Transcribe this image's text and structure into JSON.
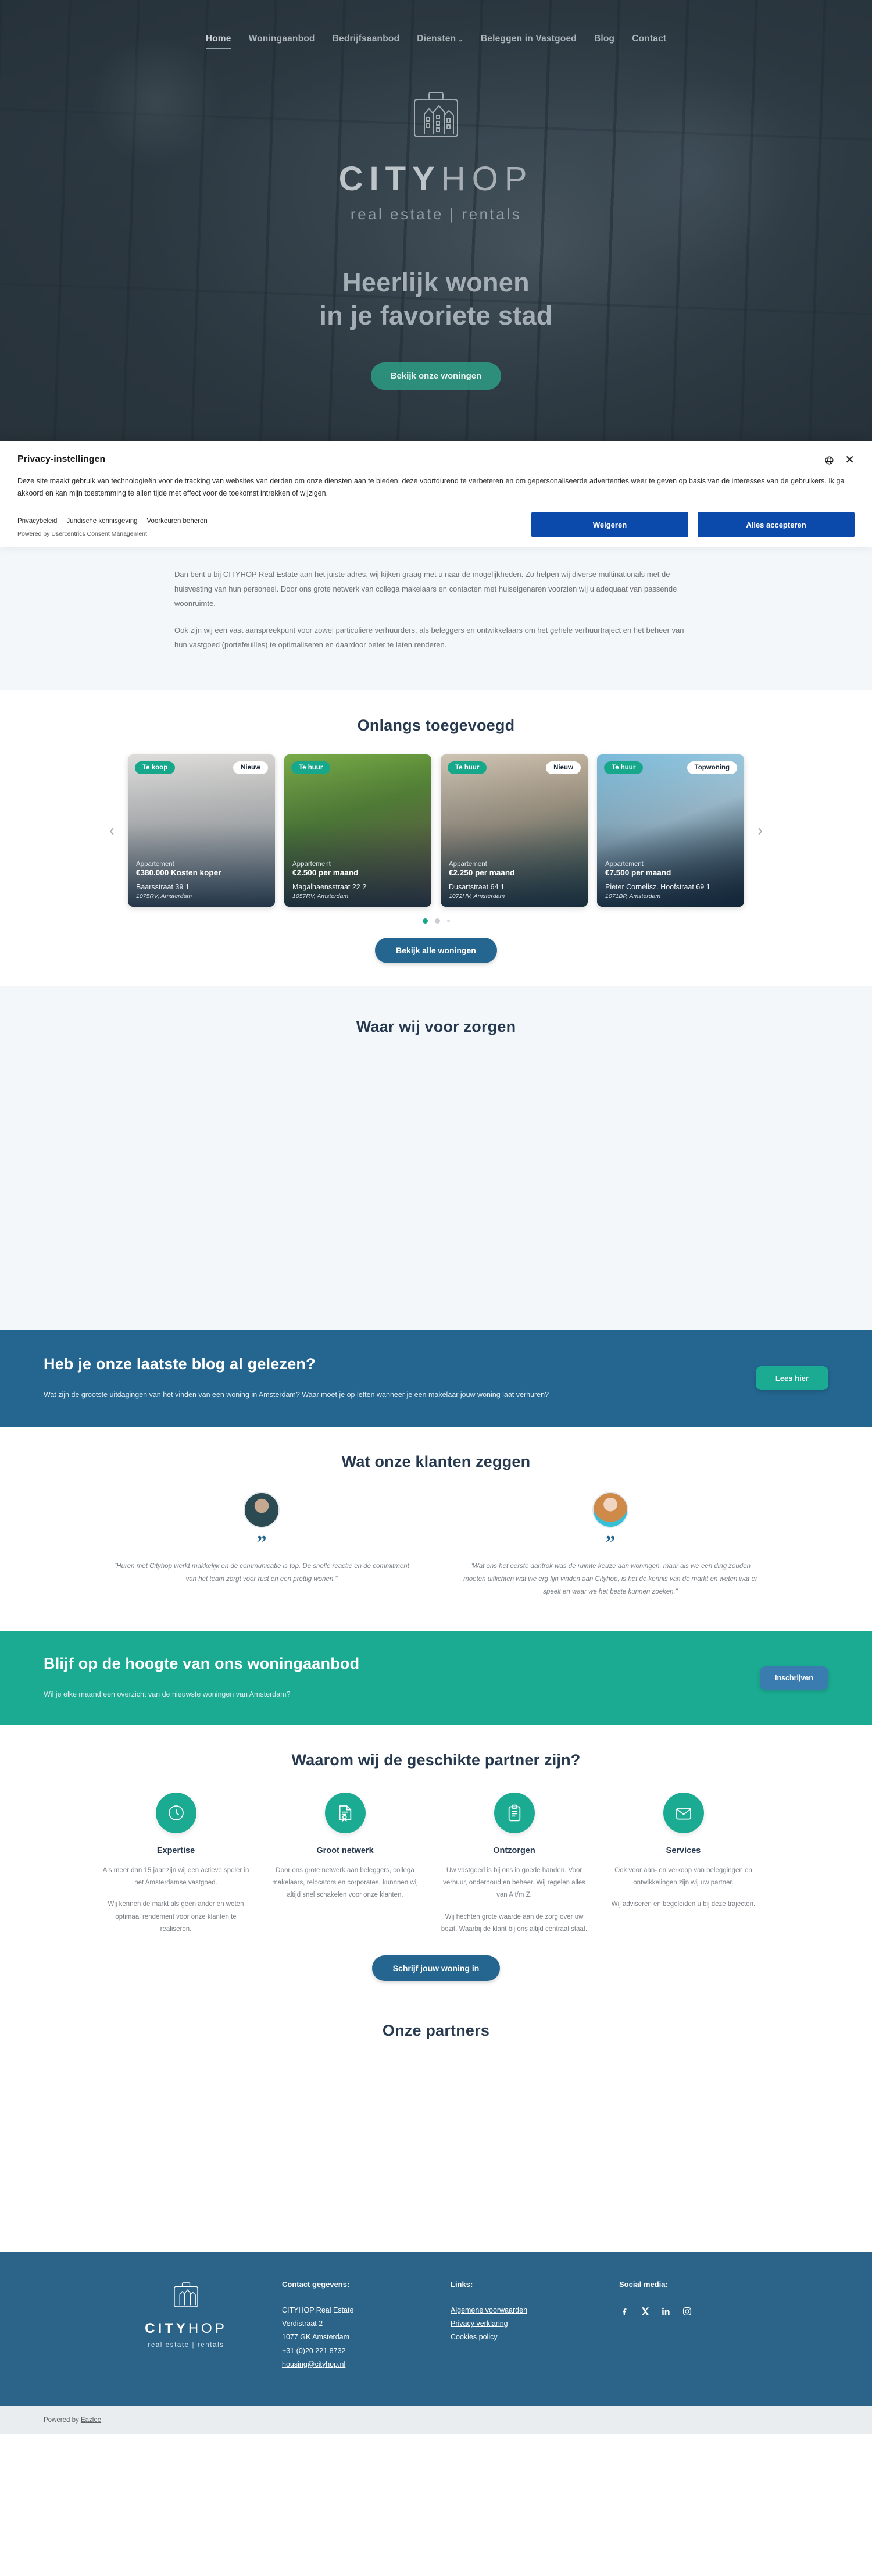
{
  "nav": {
    "items": [
      {
        "label": "Home",
        "active": true,
        "caret": false
      },
      {
        "label": "Woningaanbod",
        "active": false,
        "caret": false
      },
      {
        "label": "Bedrijfsaanbod",
        "active": false,
        "caret": false
      },
      {
        "label": "Diensten",
        "active": false,
        "caret": true
      },
      {
        "label": "Beleggen in Vastgoed",
        "active": false,
        "caret": false
      },
      {
        "label": "Blog",
        "active": false,
        "caret": false
      },
      {
        "label": "Contact",
        "active": false,
        "caret": false
      }
    ],
    "caret_glyph": "⌄"
  },
  "hero": {
    "brand_bold": "CITY",
    "brand_light": "HOP",
    "tagline": "real estate | rentals",
    "title_line1": "Heerlijk wonen",
    "title_line2": "in je favoriete stad",
    "cta": "Bekijk onze woningen"
  },
  "cookie": {
    "title": "Privacy-instellingen",
    "body": "Deze site maakt gebruik van technologieën voor de tracking van websites van derden om onze diensten aan te bieden, deze voortdurend te verbeteren en om gepersonaliseerde advertenties weer te geven op basis van de interesses van de gebruikers. Ik ga akkoord en kan mijn toestemming te allen tijde met effect voor de toekomst intrekken of wijzigen.",
    "links": [
      "Privacybeleid",
      "Juridische kennisgeving",
      "Voorkeuren beheren"
    ],
    "powered": "Powered by Usercentrics Consent Management",
    "deny": "Weigeren",
    "accept": "Alles accepteren",
    "close_glyph": "✕"
  },
  "intro": {
    "p1": "Dan bent u bij CITYHOP Real Estate aan het juiste adres, wij kijken graag met u naar de mogelijkheden. Zo helpen wij diverse multinationals met de huisvesting van hun personeel. Door ons grote netwerk van collega makelaars en contacten met huiseigenaren voorzien wij u adequaat van passende woonruimte.",
    "p2": "Ook zijn wij een vast aanspreekpunt voor zowel particuliere verhuurders, als beleggers en ontwikkelaars om het gehele verhuurtraject en het beheer van hun vastgoed (portefeuilles) te optimaliseren en daardoor beter te laten renderen."
  },
  "recent": {
    "title": "Onlangs toegevoegd",
    "arrow_left": "‹",
    "arrow_right": "›",
    "cta": "Bekijk alle woningen",
    "cards": [
      {
        "status": "Te koop",
        "tag": "Nieuw",
        "type": "Appartement",
        "price": "€380.000 Kosten koper",
        "street": "Baarsstraat 39 1",
        "zip": "1075RV, Amsterdam"
      },
      {
        "status": "Te huur",
        "tag": "",
        "type": "Appartement",
        "price": "€2.500 per maand",
        "street": "Magalhaensstraat 22 2",
        "zip": "1057RV, Amsterdam"
      },
      {
        "status": "Te huur",
        "tag": "Nieuw",
        "type": "Appartement",
        "price": "€2.250 per maand",
        "street": "Dusartstraat 64 1",
        "zip": "1072HV, Amsterdam"
      },
      {
        "status": "Te huur",
        "tag": "Topwoning",
        "type": "Appartement",
        "price": "€7.500 per maand",
        "street": "Pieter Cornelisz. Hoofstraat 69 1",
        "zip": "1071BP, Amsterdam"
      }
    ]
  },
  "zorgen": {
    "title": "Waar wij voor zorgen"
  },
  "blog": {
    "title": "Heb je onze laatste blog al gelezen?",
    "text": "Wat zijn de grootste uitdagingen van het vinden van een woning in Amsterdam? Waar moet je op letten wanneer je een makelaar jouw woning laat verhuren?",
    "cta": "Lees hier"
  },
  "testimonials": {
    "title": "Wat onze klanten zeggen",
    "quote_glyph": "”",
    "items": [
      {
        "text": "\"Huren met Cityhop werkt makkelijk en de communicatie is top. De snelle reactie en de commitment van het team zorgt voor rust en een prettig wonen.\""
      },
      {
        "text": "\"Wat ons het eerste aantrok was de ruimte keuze aan woningen, maar als we een ding zouden moeten uitlichten wat we erg fijn vinden aan Cityhop, is het de kennis van de markt en weten wat er speelt en waar we het beste kunnen zoeken.\""
      }
    ]
  },
  "newsletter": {
    "title": "Blijf op de hoogte van ons woningaanbod",
    "text": "Wil je elke maand een overzicht van de nieuwste woningen van Amsterdam?",
    "cta": "Inschrijven"
  },
  "why": {
    "title": "Waarom wij de geschikte partner zijn?",
    "cta": "Schrijf jouw woning in",
    "features": [
      {
        "icon": "clock-icon",
        "heading": "Expertise",
        "p1": "Als meer dan 15 jaar zijn wij een actieve speler in het Amsterdamse vastgoed.",
        "p2": "Wij kennen de markt als geen ander en weten optimaal rendement voor onze klanten te realiseren."
      },
      {
        "icon": "certificate-icon",
        "heading": "Groot netwerk",
        "p1": "Door ons grote netwerk aan beleggers, collega makelaars, relocators en corporates, kunnnen wij altijd snel schakelen voor onze klanten.",
        "p2": ""
      },
      {
        "icon": "clipboard-icon",
        "heading": "Ontzorgen",
        "p1": "Uw vastgoed is bij ons in goede handen. Voor verhuur, onderhoud en beheer. Wij regelen alles van A t/m Z.",
        "p2": "Wij hechten grote waarde aan de zorg over uw bezit. Waarbij de klant bij ons altijd centraal staat."
      },
      {
        "icon": "envelope-icon",
        "heading": "Services",
        "p1": "Ook voor aan- en verkoop van beleggingen en ontwikkelingen zijn wij uw partner.",
        "p2": "Wij adviseren en begeleiden u bij deze trajecten."
      }
    ]
  },
  "partners": {
    "title": "Onze partners"
  },
  "footer": {
    "brand_bold": "CITY",
    "brand_light": "HOP",
    "tagline": "real estate | rentals",
    "contact_heading": "Contact gegevens:",
    "contact_lines": [
      "CITYHOP Real Estate",
      "Verdistraat 2",
      "1077 GK Amsterdam",
      "+31 (0)20 221 8732"
    ],
    "contact_email": "housing@cityhop.nl",
    "links_heading": "Links:",
    "links": [
      "Algemene voorwaarden",
      "Privacy verklaring",
      "Cookies policy"
    ],
    "social_heading": "Social media:",
    "social": [
      "facebook-icon",
      "x-icon",
      "linkedin-icon",
      "instagram-icon"
    ],
    "powered_prefix": "Powered by ",
    "powered_link": "Eazlee"
  }
}
